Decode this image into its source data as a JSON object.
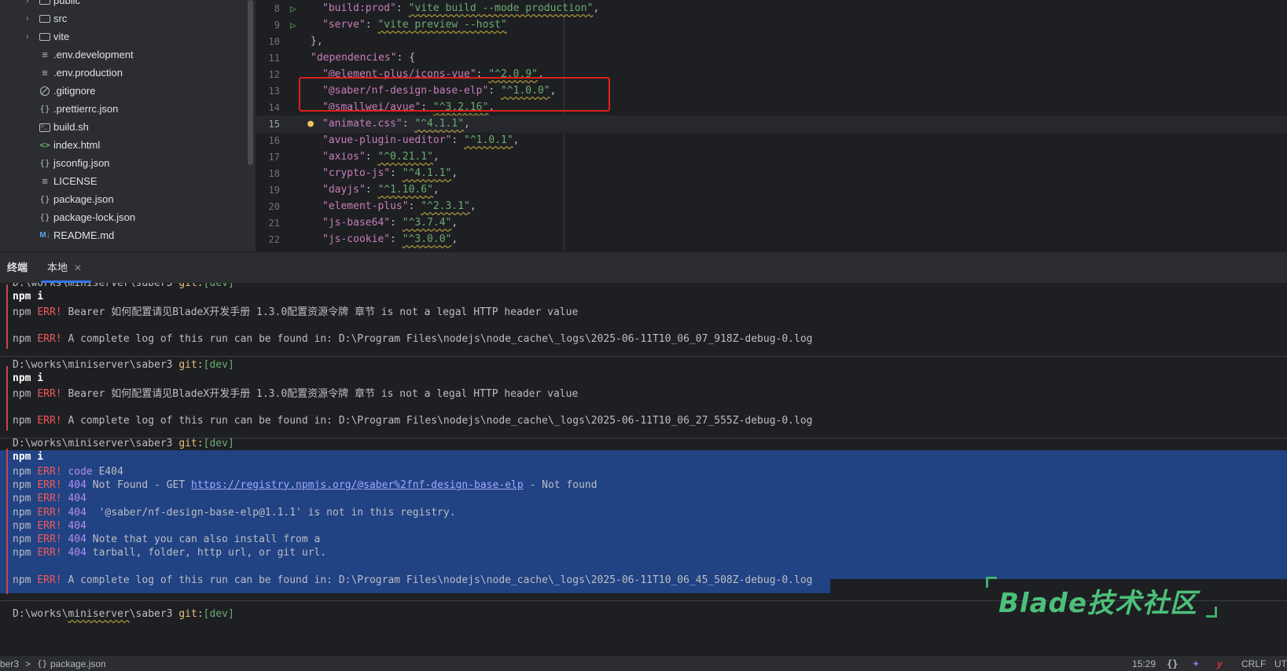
{
  "project_tree": {
    "items": [
      {
        "label": "public",
        "icon": "folder-icon",
        "expandable": true
      },
      {
        "label": "src",
        "icon": "folder-icon",
        "expandable": true
      },
      {
        "label": "vite",
        "icon": "folder-icon",
        "expandable": true
      },
      {
        "label": ".env.development",
        "icon": "text-file-icon",
        "expandable": false
      },
      {
        "label": ".env.production",
        "icon": "text-file-icon",
        "expandable": false
      },
      {
        "label": ".gitignore",
        "icon": "ignore-file-icon",
        "expandable": false
      },
      {
        "label": ".prettierrc.json",
        "icon": "json-file-icon",
        "expandable": false
      },
      {
        "label": "build.sh",
        "icon": "shell-file-icon",
        "expandable": false
      },
      {
        "label": "index.html",
        "icon": "html-file-icon",
        "expandable": false
      },
      {
        "label": "jsconfig.json",
        "icon": "json-file-icon",
        "expandable": false
      },
      {
        "label": "LICENSE",
        "icon": "text-file-icon",
        "expandable": false
      },
      {
        "label": "package.json",
        "icon": "json-file-icon",
        "expandable": false
      },
      {
        "label": "package-lock.json",
        "icon": "json-file-icon",
        "expandable": false
      },
      {
        "label": "README.md",
        "icon": "markdown-file-icon",
        "expandable": false
      }
    ]
  },
  "editor": {
    "current_line": 15,
    "lines": [
      {
        "num": "8",
        "key": "\"build:prod\"",
        "value": "\"vite build --mode production\"",
        "tail": ",",
        "run": true
      },
      {
        "num": "9",
        "key": "\"serve\"",
        "value": "\"vite preview --host\"",
        "tail": "",
        "run": true
      },
      {
        "num": "10",
        "text": "},"
      },
      {
        "num": "11",
        "key": "\"dependencies\"",
        "tail": ": {",
        "indent": 1
      },
      {
        "num": "12",
        "key": "\"@element-plus/icons-vue\"",
        "value": "\"^2.0.9\"",
        "tail": ","
      },
      {
        "num": "13",
        "key": "\"@saber/nf-design-base-elp\"",
        "value": "\"^1.0.0\"",
        "tail": ","
      },
      {
        "num": "14",
        "key": "\"@smallwei/avue\"",
        "value": "\"^3.2.16\"",
        "tail": ","
      },
      {
        "num": "15",
        "key": "\"animate.css\"",
        "value": "\"^4.1.1\"",
        "tail": ",",
        "bulb": true
      },
      {
        "num": "16",
        "key": "\"avue-plugin-ueditor\"",
        "value": "\"^1.0.1\"",
        "tail": ","
      },
      {
        "num": "17",
        "key": "\"axios\"",
        "value": "\"^0.21.1\"",
        "tail": ","
      },
      {
        "num": "18",
        "key": "\"crypto-js\"",
        "value": "\"^4.1.1\"",
        "tail": ","
      },
      {
        "num": "19",
        "key": "\"dayjs\"",
        "value": "\"^1.10.6\"",
        "tail": ","
      },
      {
        "num": "20",
        "key": "\"element-plus\"",
        "value": "\"^2.3.1\"",
        "tail": ","
      },
      {
        "num": "21",
        "key": "\"js-base64\"",
        "value": "\"^3.7.4\"",
        "tail": ","
      },
      {
        "num": "22",
        "key": "\"js-cookie\"",
        "value": "\"^3.0.0\"",
        "tail": ","
      }
    ]
  },
  "terminal": {
    "tabs": {
      "title": "终端",
      "local": "本地"
    },
    "prompt_path": "D:\\works\\miniserver\\saber3",
    "git_label": "git:",
    "branch": "[dev]",
    "command": "npm i",
    "npm": "npm",
    "err": "ERR!",
    "blocks": [
      {
        "bearer_msg": " Bearer 如何配置请见BladeX开发手册 1.3.0配置资源令牌 章节 is not a legal HTTP header value",
        "log_msg": " A complete log of this run can be found in: D:\\Program Files\\nodejs\\node_cache\\_logs\\2025-06-11T10_06_07_918Z-debug-0.log"
      },
      {
        "bearer_msg": " Bearer 如何配置请见BladeX开发手册 1.3.0配置资源令牌 章节 is not a legal HTTP header value",
        "log_msg": " A complete log of this run can be found in: D:\\Program Files\\nodejs\\node_cache\\_logs\\2025-06-11T10_06_27_555Z-debug-0.log"
      },
      {
        "code_label": "code",
        "code_value": " E404",
        "c404": "404",
        "not_found_pre": " Not Found - GET ",
        "not_found_url": "https://registry.npmjs.org/@saber%2fnf-design-base-elp",
        "not_found_post": " - Not found",
        "registry_msg": "  '@saber/nf-design-base-elp@1.1.1' is not in this registry.",
        "install_msg": " Note that you can also install from a",
        "tarball_msg": " tarball, folder, http url, or git url.",
        "log_msg": " A complete log of this run can be found in: D:\\Program Files\\nodejs\\node_cache\\_logs\\2025-06-11T10_06_45_508Z-debug-0.log"
      }
    ],
    "final_prompt": {
      "pre": "D:\\works\\",
      "underlined": "miniserver",
      "post": "\\saber3"
    }
  },
  "watermark": {
    "text": "Blade技术社区"
  },
  "statusbar": {
    "crumb_project": "ber3",
    "crumb_sep": ">",
    "crumb_file": "package.json",
    "position": "15:29",
    "braces": "{}",
    "line_ending": "CRLF",
    "encoding": "UT"
  }
}
